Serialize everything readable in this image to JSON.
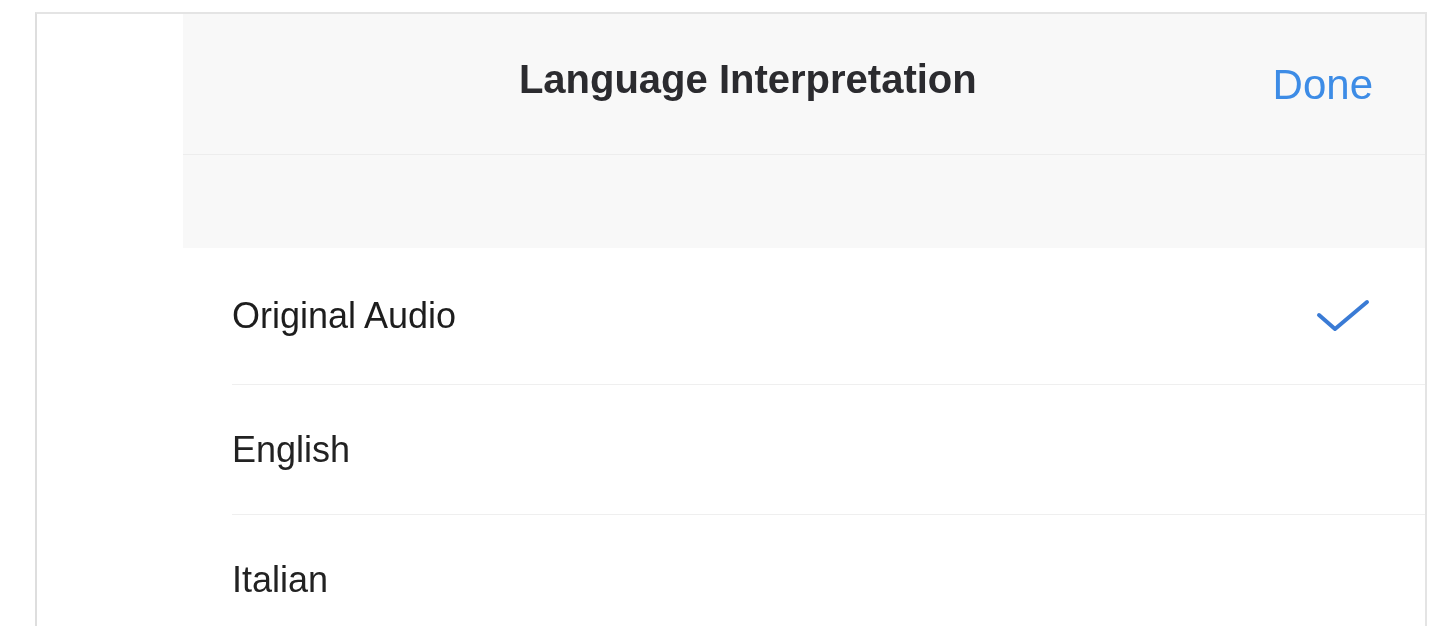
{
  "header": {
    "title": "Language Interpretation",
    "done": "Done"
  },
  "options": [
    {
      "label": "Original Audio",
      "selected": true
    },
    {
      "label": "English",
      "selected": false
    },
    {
      "label": "Italian",
      "selected": false
    }
  ]
}
